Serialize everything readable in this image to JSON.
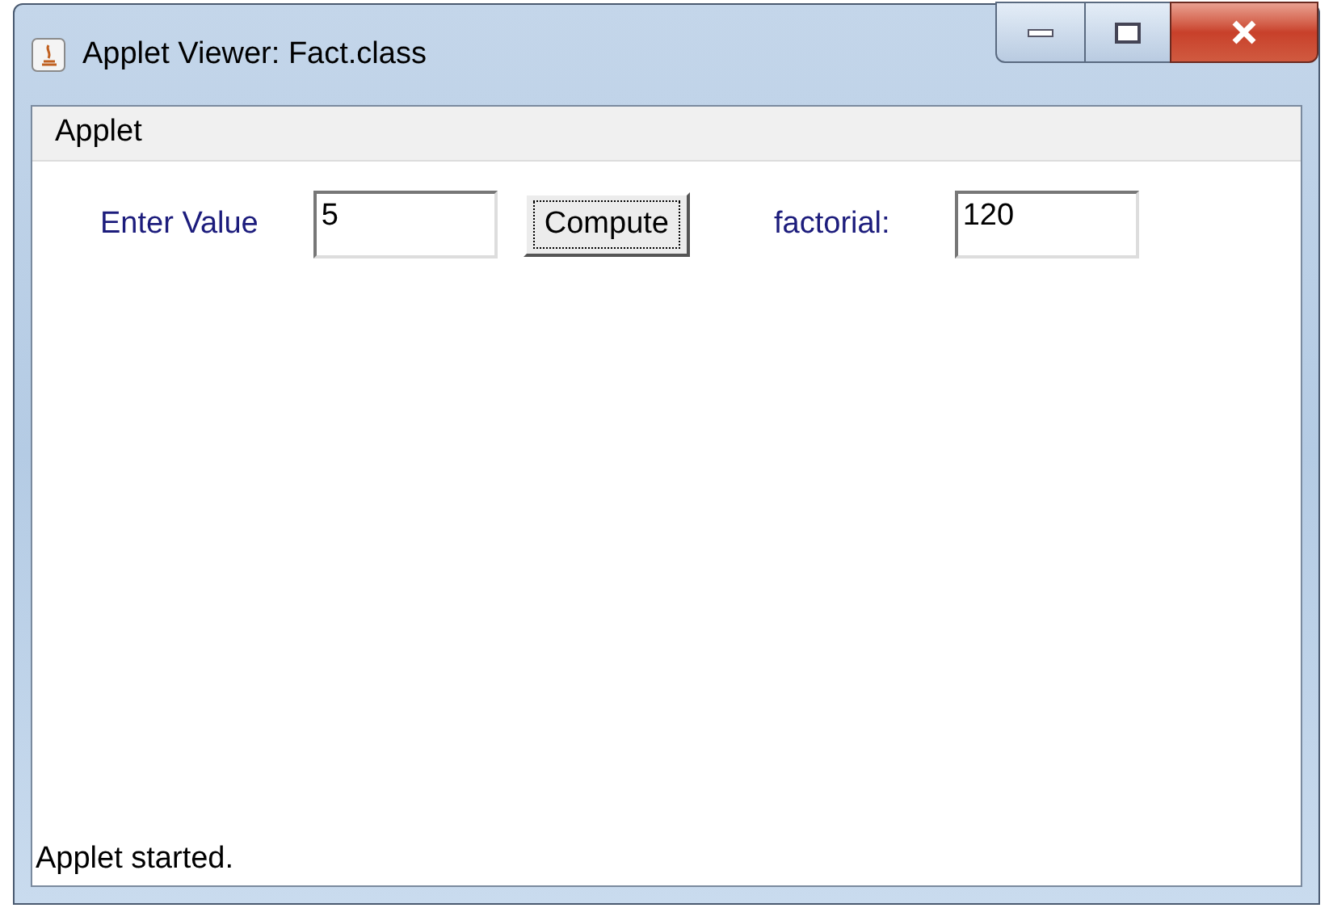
{
  "window": {
    "title": "Applet Viewer: Fact.class"
  },
  "menu_bar": {
    "items": [
      "Applet"
    ]
  },
  "form": {
    "input_label": "Enter Value",
    "input_value": "5",
    "button": {
      "label": "Compute",
      "focused": true
    },
    "result_label": "factorial:",
    "result_value": "120"
  },
  "status_bar": {
    "text": "Applet started."
  }
}
